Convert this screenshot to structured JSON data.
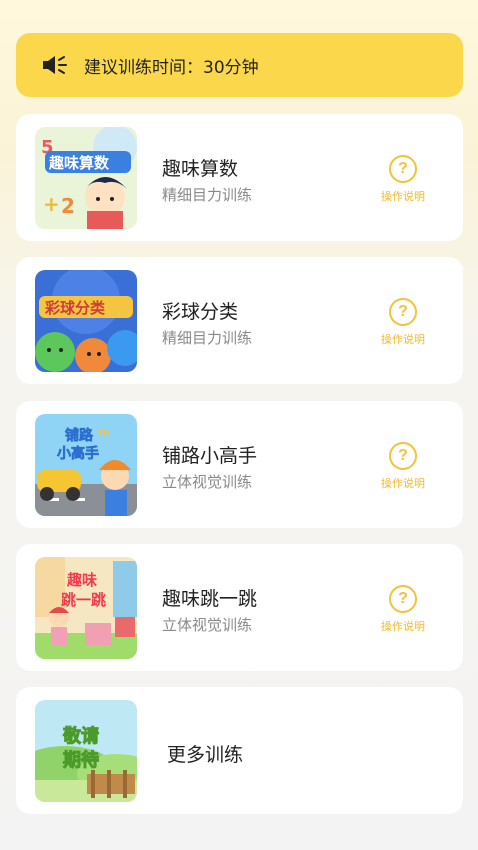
{
  "banner": {
    "icon": "speaker-icon",
    "text": "建议训练时间：30分钟"
  },
  "items": [
    {
      "title": "趣味算数",
      "subtitle": "精细目力训练",
      "help_label": "操作说明",
      "thumb_text": "趣味算数"
    },
    {
      "title": "彩球分类",
      "subtitle": "精细目力训练",
      "help_label": "操作说明",
      "thumb_text": "彩球分类"
    },
    {
      "title": "铺路小高手",
      "subtitle": "立体视觉训练",
      "help_label": "操作说明",
      "thumb_text_1": "铺路",
      "thumb_text_2": "小高手",
      "thumb_badge": "3D"
    },
    {
      "title": "趣味跳一跳",
      "subtitle": "立体视觉训练",
      "help_label": "操作说明",
      "thumb_text_1": "趣味",
      "thumb_text_2": "跳一跳"
    }
  ],
  "more": {
    "title": "更多训练",
    "thumb_text_1": "敬请",
    "thumb_text_2": "期待"
  },
  "colors": {
    "banner_bg": "#fbd84b",
    "help_accent": "#f0c33a",
    "subtitle": "#8a8a8a"
  }
}
